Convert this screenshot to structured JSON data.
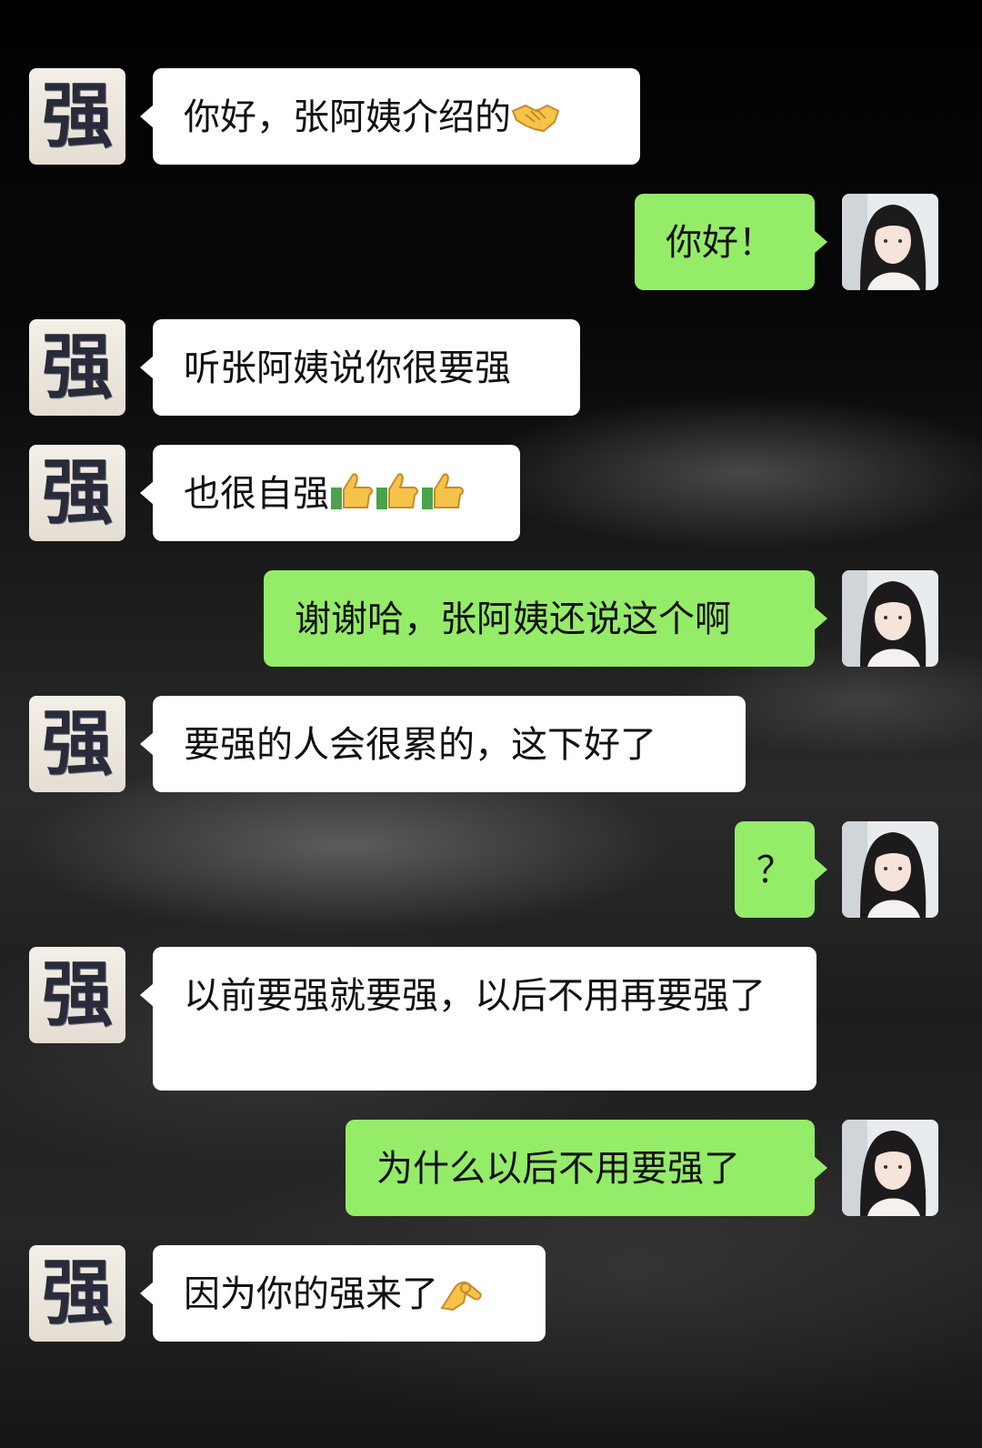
{
  "contacts": {
    "other": {
      "avatar_char": "强"
    },
    "me": {
      "avatar_icon": "girl-portrait"
    }
  },
  "messages": [
    {
      "from": "other",
      "text": "你好，张阿姨介绍的",
      "emoji": [
        "handshake"
      ]
    },
    {
      "from": "me",
      "text": "你好！"
    },
    {
      "from": "other",
      "text": "听张阿姨说你很要强"
    },
    {
      "from": "other",
      "text": "也很自强",
      "emoji": [
        "thumbs-up",
        "thumbs-up",
        "thumbs-up"
      ]
    },
    {
      "from": "me",
      "text": "谢谢哈，张阿姨还说这个啊"
    },
    {
      "from": "other",
      "text": "要强的人会很累的，这下好了"
    },
    {
      "from": "me",
      "text": "？"
    },
    {
      "from": "other",
      "text": "以前要强就要强，以后不用再要强了"
    },
    {
      "from": "me",
      "text": "为什么以后不用要强了"
    },
    {
      "from": "other",
      "text": "因为你的强来了",
      "emoji": [
        "ok-hand"
      ]
    }
  ],
  "colors": {
    "incoming_bubble": "#ffffff",
    "outgoing_bubble": "#95ec69",
    "background": "#0a0a0a"
  }
}
